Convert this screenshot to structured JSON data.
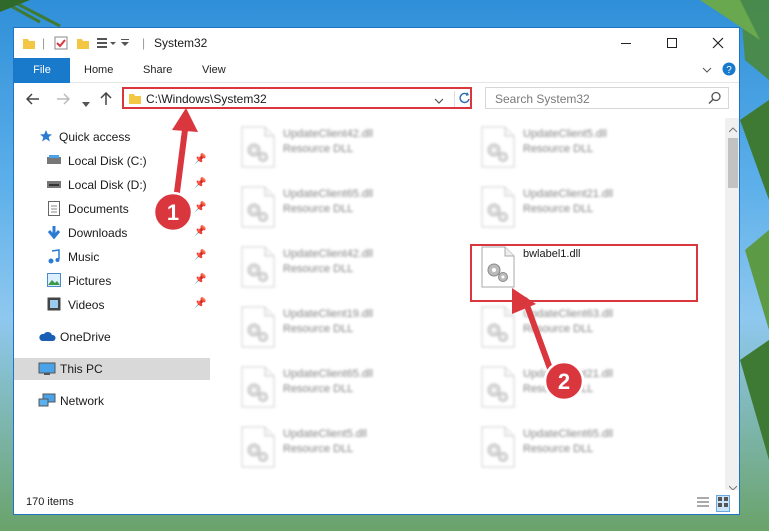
{
  "window": {
    "title": "System32"
  },
  "ribbon": {
    "tabs": [
      "File",
      "Home",
      "Share",
      "View"
    ]
  },
  "address": {
    "path": "C:\\Windows\\System32",
    "search_placeholder": "Search System32"
  },
  "sidebar": {
    "items": [
      {
        "label": "Quick access",
        "icon": "star-icon",
        "pinned": false
      },
      {
        "label": "Local Disk (C:)",
        "icon": "drive-icon",
        "pinned": true
      },
      {
        "label": "Local Disk (D:)",
        "icon": "drive-icon",
        "pinned": true
      },
      {
        "label": "Documents",
        "icon": "document-icon",
        "pinned": true
      },
      {
        "label": "Downloads",
        "icon": "download-icon",
        "pinned": true
      },
      {
        "label": "Music",
        "icon": "music-icon",
        "pinned": true
      },
      {
        "label": "Pictures",
        "icon": "picture-icon",
        "pinned": true
      },
      {
        "label": "Videos",
        "icon": "video-icon",
        "pinned": true
      },
      {
        "label": "OneDrive",
        "icon": "cloud-icon",
        "pinned": false
      },
      {
        "label": "This PC",
        "icon": "computer-icon",
        "pinned": false
      },
      {
        "label": "Network",
        "icon": "network-icon",
        "pinned": false
      }
    ]
  },
  "files": [
    {
      "name": "UpdateClient42.dll",
      "type": "Resource DLL"
    },
    {
      "name": "UpdateClient5.dll",
      "type": "Resource DLL"
    },
    {
      "name": "UpdateClient65.dll",
      "type": "Resource DLL"
    },
    {
      "name": "UpdateClient21.dll",
      "type": "Resource DLL"
    },
    {
      "name": "UpdateClient42.dll",
      "type": "Resource DLL"
    },
    {
      "name": "bwlabel1.dll",
      "type": ""
    },
    {
      "name": "UpdateClient19.dll",
      "type": "Resource DLL"
    },
    {
      "name": "UpdateClient63.dll",
      "type": "Resource DLL"
    },
    {
      "name": "UpdateClient65.dll",
      "type": "Resource DLL"
    },
    {
      "name": "UpdateClient21.dll",
      "type": "Resource DLL"
    },
    {
      "name": "UpdateClient5.dll",
      "type": "Resource DLL"
    },
    {
      "name": "UpdateClient65.dll",
      "type": "Resource DLL"
    }
  ],
  "status": {
    "item_count": "170 items"
  },
  "annotations": {
    "step1": "1",
    "step2": "2"
  },
  "colors": {
    "accent": "#1979ca",
    "highlight": "#d9363e"
  }
}
